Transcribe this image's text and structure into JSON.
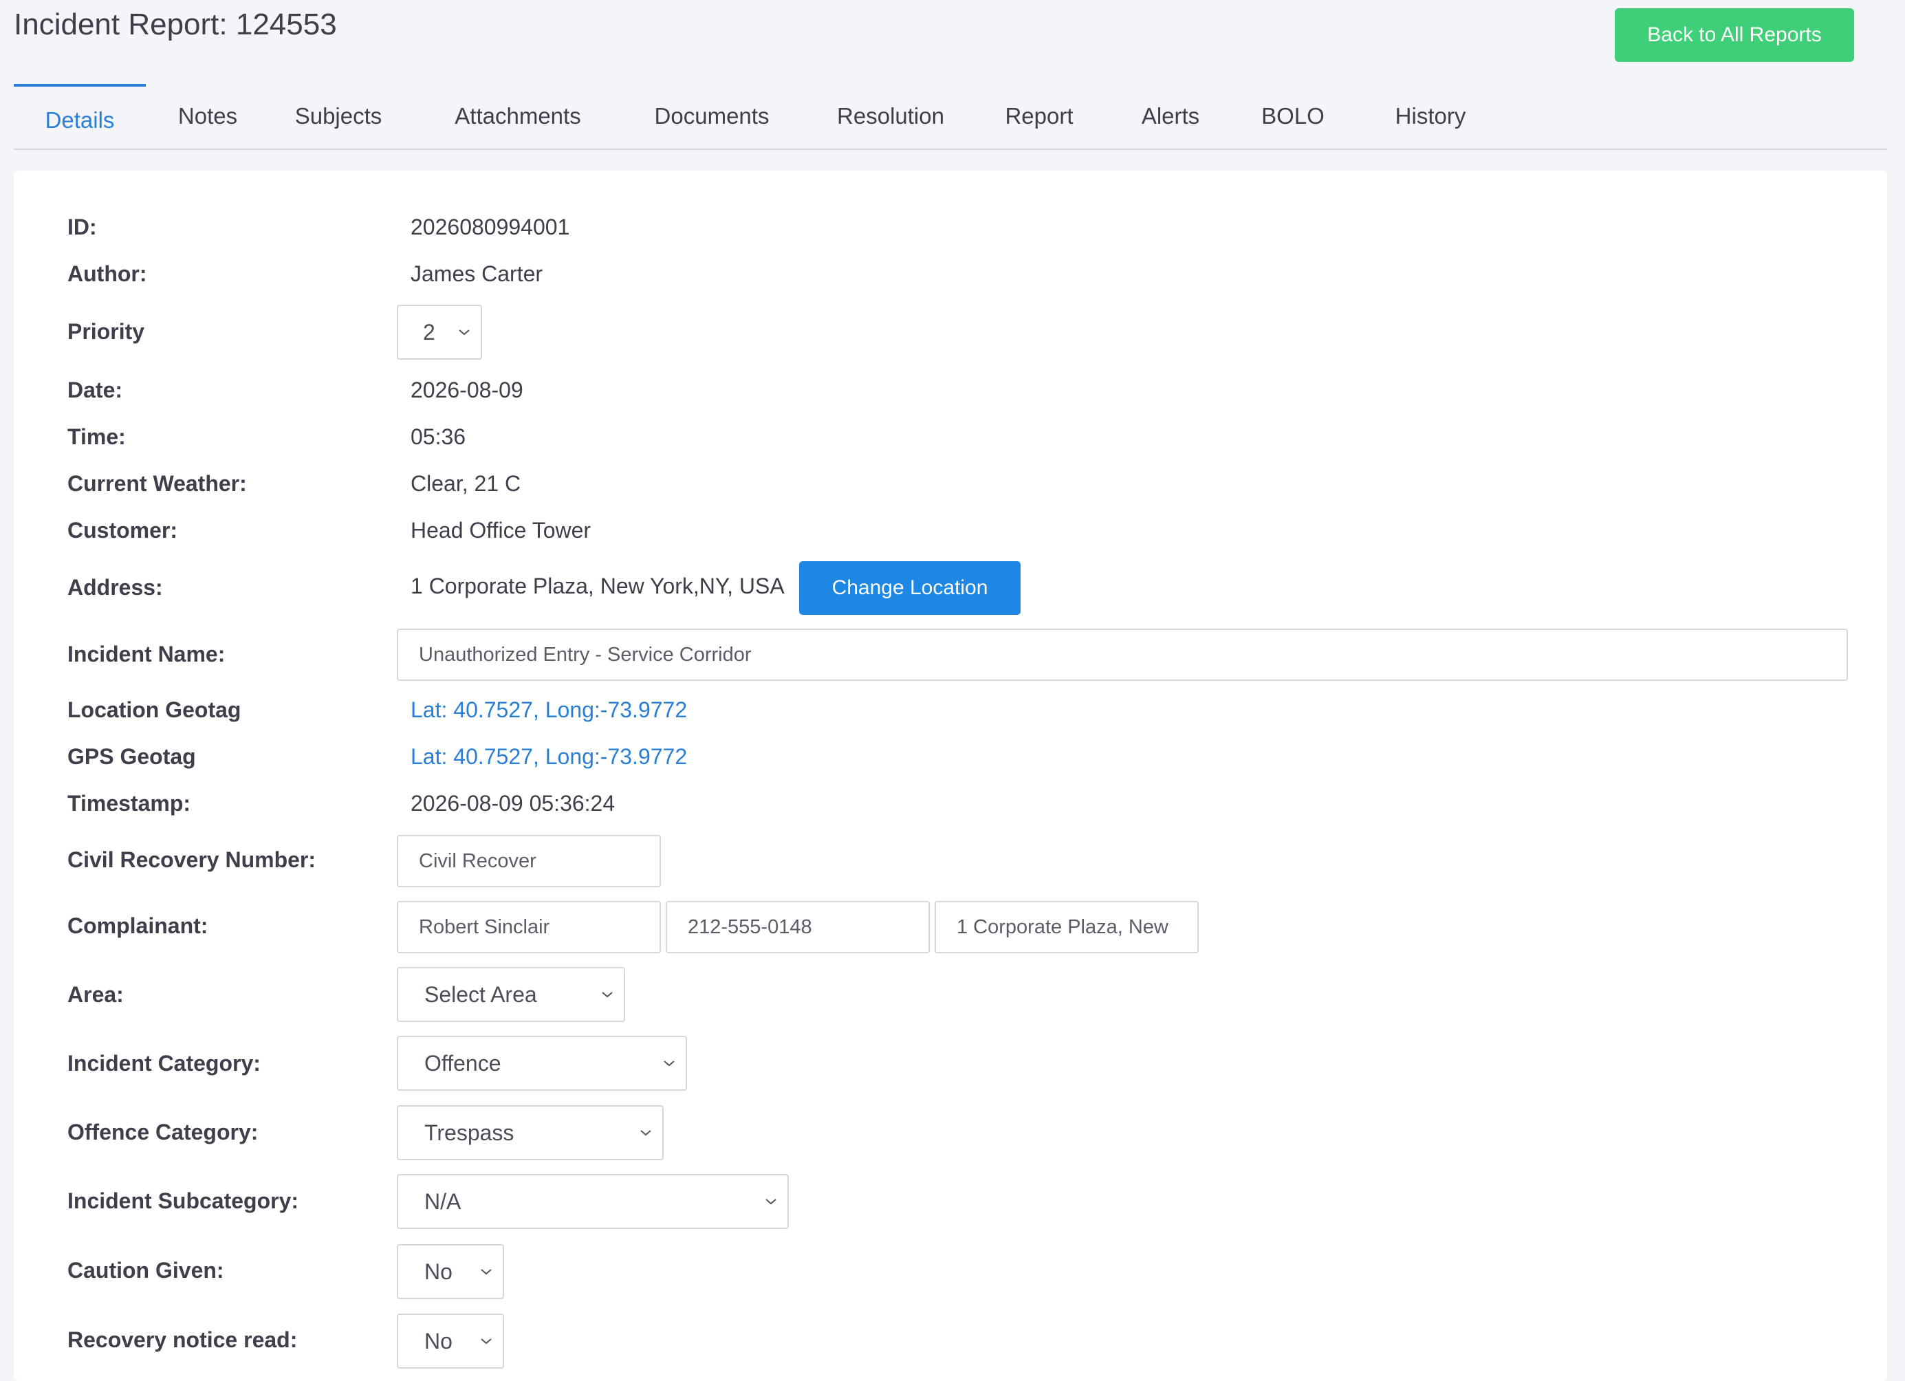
{
  "header": {
    "title": "Incident Report: 124553",
    "back_label": "Back to All Reports"
  },
  "tabs": [
    {
      "label": "Details"
    },
    {
      "label": "Notes"
    },
    {
      "label": "Subjects"
    },
    {
      "label": "Attachments"
    },
    {
      "label": "Documents"
    },
    {
      "label": "Resolution"
    },
    {
      "label": "Report"
    },
    {
      "label": "Alerts"
    },
    {
      "label": "BOLO"
    },
    {
      "label": "History"
    }
  ],
  "active_tab": "Details",
  "details": {
    "id_label": "ID:",
    "id_value": "2026080994001",
    "author_label": "Author:",
    "author_value": "James Carter",
    "priority_label": "Priority",
    "priority_value": "2",
    "date_label": "Date:",
    "date_value": "2026-08-09",
    "time_label": "Time:",
    "time_value": "05:36",
    "weather_label": "Current Weather:",
    "weather_value": "Clear, 21 C",
    "customer_label": "Customer:",
    "customer_value": "Head Office Tower",
    "address_label": "Address:",
    "address_value": "1 Corporate Plaza, New York,NY, USA",
    "change_location_label": "Change Location",
    "incident_name_label": "Incident Name:",
    "incident_name_value": "Unauthorized Entry - Service Corridor",
    "location_geotag_label": "Location Geotag",
    "location_geotag_value": "Lat: 40.7527, Long:-73.9772",
    "gps_geotag_label": "GPS Geotag",
    "gps_geotag_value": "Lat: 40.7527, Long:-73.9772",
    "timestamp_label": "Timestamp:",
    "timestamp_value": "2026-08-09 05:36:24",
    "civil_recovery_label": "Civil Recovery Number:",
    "civil_recovery_placeholder": "Civil Recover",
    "complainant_label": "Complainant:",
    "complainant_name": "Robert Sinclair",
    "complainant_phone": "212-555-0148",
    "complainant_address": "1 Corporate Plaza, New",
    "area_label": "Area:",
    "area_value": "Select Area",
    "incident_category_label": "Incident Category:",
    "incident_category_value": "Offence",
    "offence_category_label": "Offence Category:",
    "offence_category_value": "Trespass",
    "incident_subcategory_label": "Incident Subcategory:",
    "incident_subcategory_value": "N/A",
    "caution_label": "Caution Given:",
    "caution_value": "No",
    "recovery_notice_label": "Recovery notice read:",
    "recovery_notice_value": "No"
  },
  "colors": {
    "accent": "#2a7fd4",
    "success": "#3ecf78",
    "primary_button": "#1e86e3"
  }
}
